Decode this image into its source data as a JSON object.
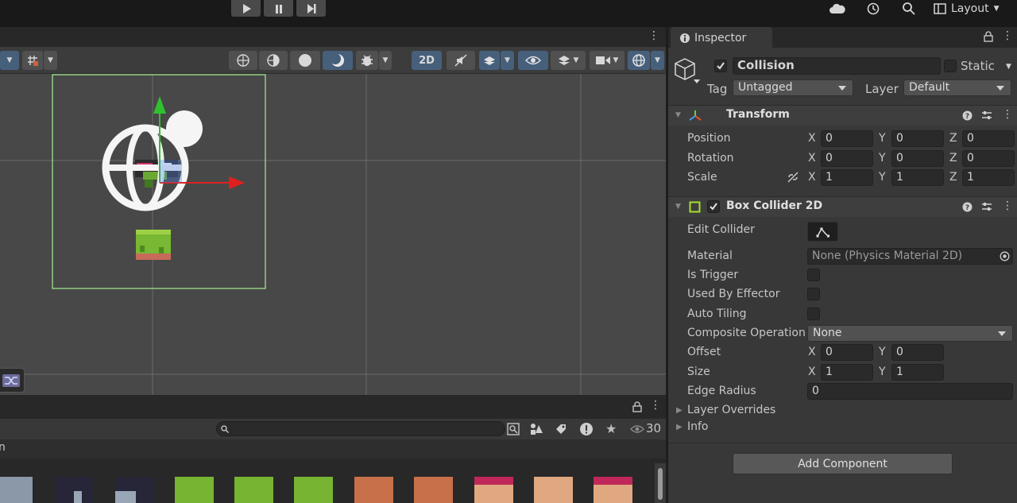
{
  "toolbar": {
    "layout_label": "Layout",
    "play_icon": "play-icon",
    "pause_icon": "pause-icon",
    "step_icon": "step-icon"
  },
  "scene_toolbar": {
    "mode_2d_label": "2D"
  },
  "project_panel": {
    "search_placeholder": "",
    "item_count": "30",
    "path_fragment": "n"
  },
  "inspector": {
    "tab_label": "Inspector",
    "object_name": "Collision",
    "static_label": "Static",
    "tag_label": "Tag",
    "tag_value": "Untagged",
    "layer_label": "Layer",
    "layer_value": "Default",
    "transform": {
      "title": "Transform",
      "position_label": "Position",
      "rotation_label": "Rotation",
      "scale_label": "Scale",
      "axis_x": "X",
      "axis_y": "Y",
      "axis_z": "Z",
      "position": [
        "0",
        "0",
        "0"
      ],
      "rotation": [
        "0",
        "0",
        "0"
      ],
      "scale": [
        "1",
        "1",
        "1"
      ]
    },
    "box_collider": {
      "title": "Box Collider 2D",
      "edit_collider_label": "Edit Collider",
      "material_label": "Material",
      "material_value": "None (Physics Material 2D)",
      "is_trigger_label": "Is Trigger",
      "used_by_effector_label": "Used By Effector",
      "auto_tiling_label": "Auto Tiling",
      "composite_operation_label": "Composite Operation",
      "composite_operation_value": "None",
      "offset_label": "Offset",
      "offset": [
        "0",
        "0"
      ],
      "size_label": "Size",
      "size": [
        "1",
        "1"
      ],
      "edge_radius_label": "Edge Radius",
      "edge_radius_value": "0",
      "layer_overrides_label": "Layer Overrides",
      "info_label": "Info"
    },
    "add_component_label": "Add Component"
  },
  "colors": {
    "accent_blue": "#46607c",
    "selection_green": "#8fe07a",
    "gizmo_red": "#e02020",
    "gizmo_green": "#30c030"
  }
}
